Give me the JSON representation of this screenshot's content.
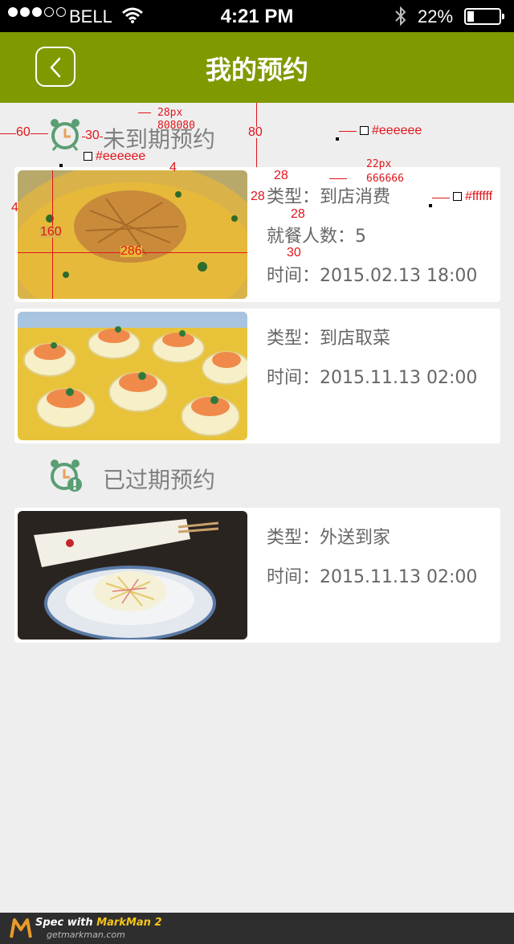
{
  "status_bar": {
    "carrier": "BELL",
    "time": "4:21 PM",
    "battery_text": "22%",
    "battery_level": 0.22
  },
  "nav": {
    "title": "我的预约",
    "back_icon": "chevron-left-icon"
  },
  "sections": [
    {
      "title": "未到期预约",
      "icon": "alarm-clock-icon",
      "cards": [
        {
          "photo": "noodle-soup-photo",
          "rows": [
            "类型：到店消费",
            "就餐人数：5",
            "时间：2015.02.13 18:00"
          ]
        },
        {
          "photo": "shrimp-tofu-photo",
          "rows": [
            "类型：到店取菜",
            "时间：2015.11.13 02:00"
          ]
        }
      ]
    },
    {
      "title": "已过期预约",
      "icon": "alarm-clock-expired-icon",
      "cards": [
        {
          "photo": "shredded-vegetable-plate-photo",
          "rows": [
            "类型：外送到家",
            "时间：2015.11.13 02:00"
          ]
        }
      ]
    }
  ],
  "annotations": {
    "left_margin": "60",
    "icon_gap": "30",
    "title_font": "28px",
    "title_color": "808080",
    "header_height": "80",
    "bg_color": "#eeeeee",
    "card_bg_color": "#eeeeee",
    "card_top_gap": "4",
    "card_left_gap": "4",
    "photo_height": "160",
    "photo_width": "286",
    "info_font": "22px",
    "info_color": "666666",
    "info_top": "28",
    "info_left": "28",
    "row_gap": "28",
    "row_gap2": "30",
    "white_color": "#ffffff"
  },
  "footer": {
    "brand_prefix": "Spec with ",
    "brand_name": "MarkMan 2",
    "url": "getmarkman.com"
  }
}
